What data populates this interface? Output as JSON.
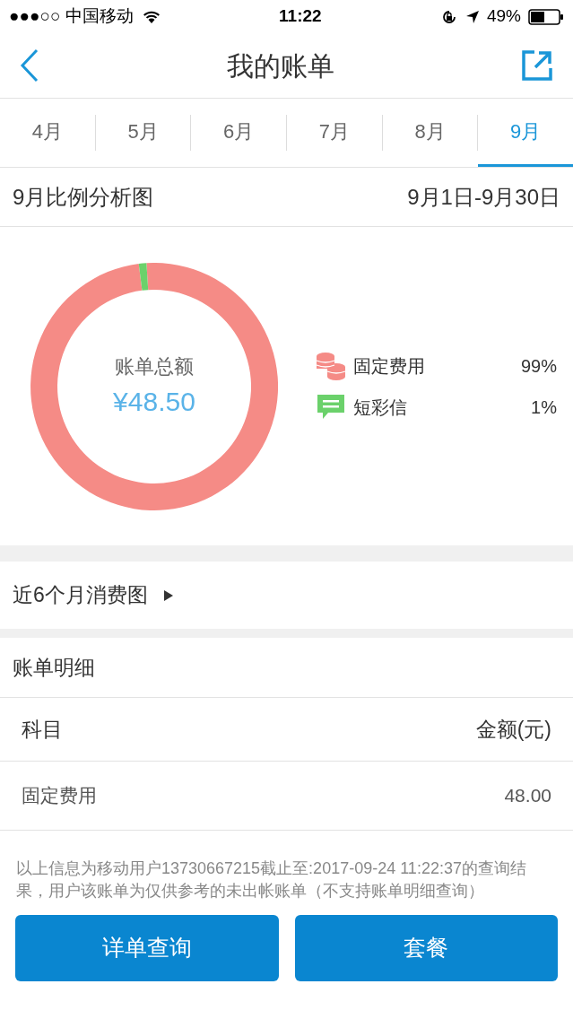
{
  "status_bar": {
    "carrier": "●●●○○ 中国移动",
    "time": "11:22",
    "battery": "49%"
  },
  "nav": {
    "title": "我的账单"
  },
  "tabs": [
    {
      "label": "4月",
      "selected": false
    },
    {
      "label": "5月",
      "selected": false
    },
    {
      "label": "6月",
      "selected": false
    },
    {
      "label": "7月",
      "selected": false
    },
    {
      "label": "8月",
      "selected": false
    },
    {
      "label": "9月",
      "selected": true
    }
  ],
  "analysis": {
    "title": "9月比例分析图",
    "range": "9月1日-9月30日",
    "total": "¥48.50",
    "legend": [
      {
        "kind": "coins",
        "color": "#f58b86"
      },
      {
        "kind": "message",
        "color": "#6bd16b"
      }
    ],
    "chart_data": {
      "type": "donut",
      "categories": [
        "固定费用",
        "短彩信"
      ],
      "series": [
        {
          "name": "账单总额",
          "values": [
            99,
            1
          ]
        }
      ],
      "value_labels": [
        "99%",
        "1%"
      ]
    }
  },
  "history_link": "近6个月消费图",
  "details": {
    "title": "账单明细",
    "columns": [
      "科目",
      "金额(元)"
    ],
    "rows": [
      [
        "固定费用",
        "48.00"
      ]
    ]
  },
  "note": "以上信息为移动用户13730667215截止至:2017-09-24 11:22:37的查询结果，用户该账单为仅供参考的未出帐账单（不支持账单明细查询）",
  "buttons": [
    "详单查询",
    "套餐"
  ]
}
